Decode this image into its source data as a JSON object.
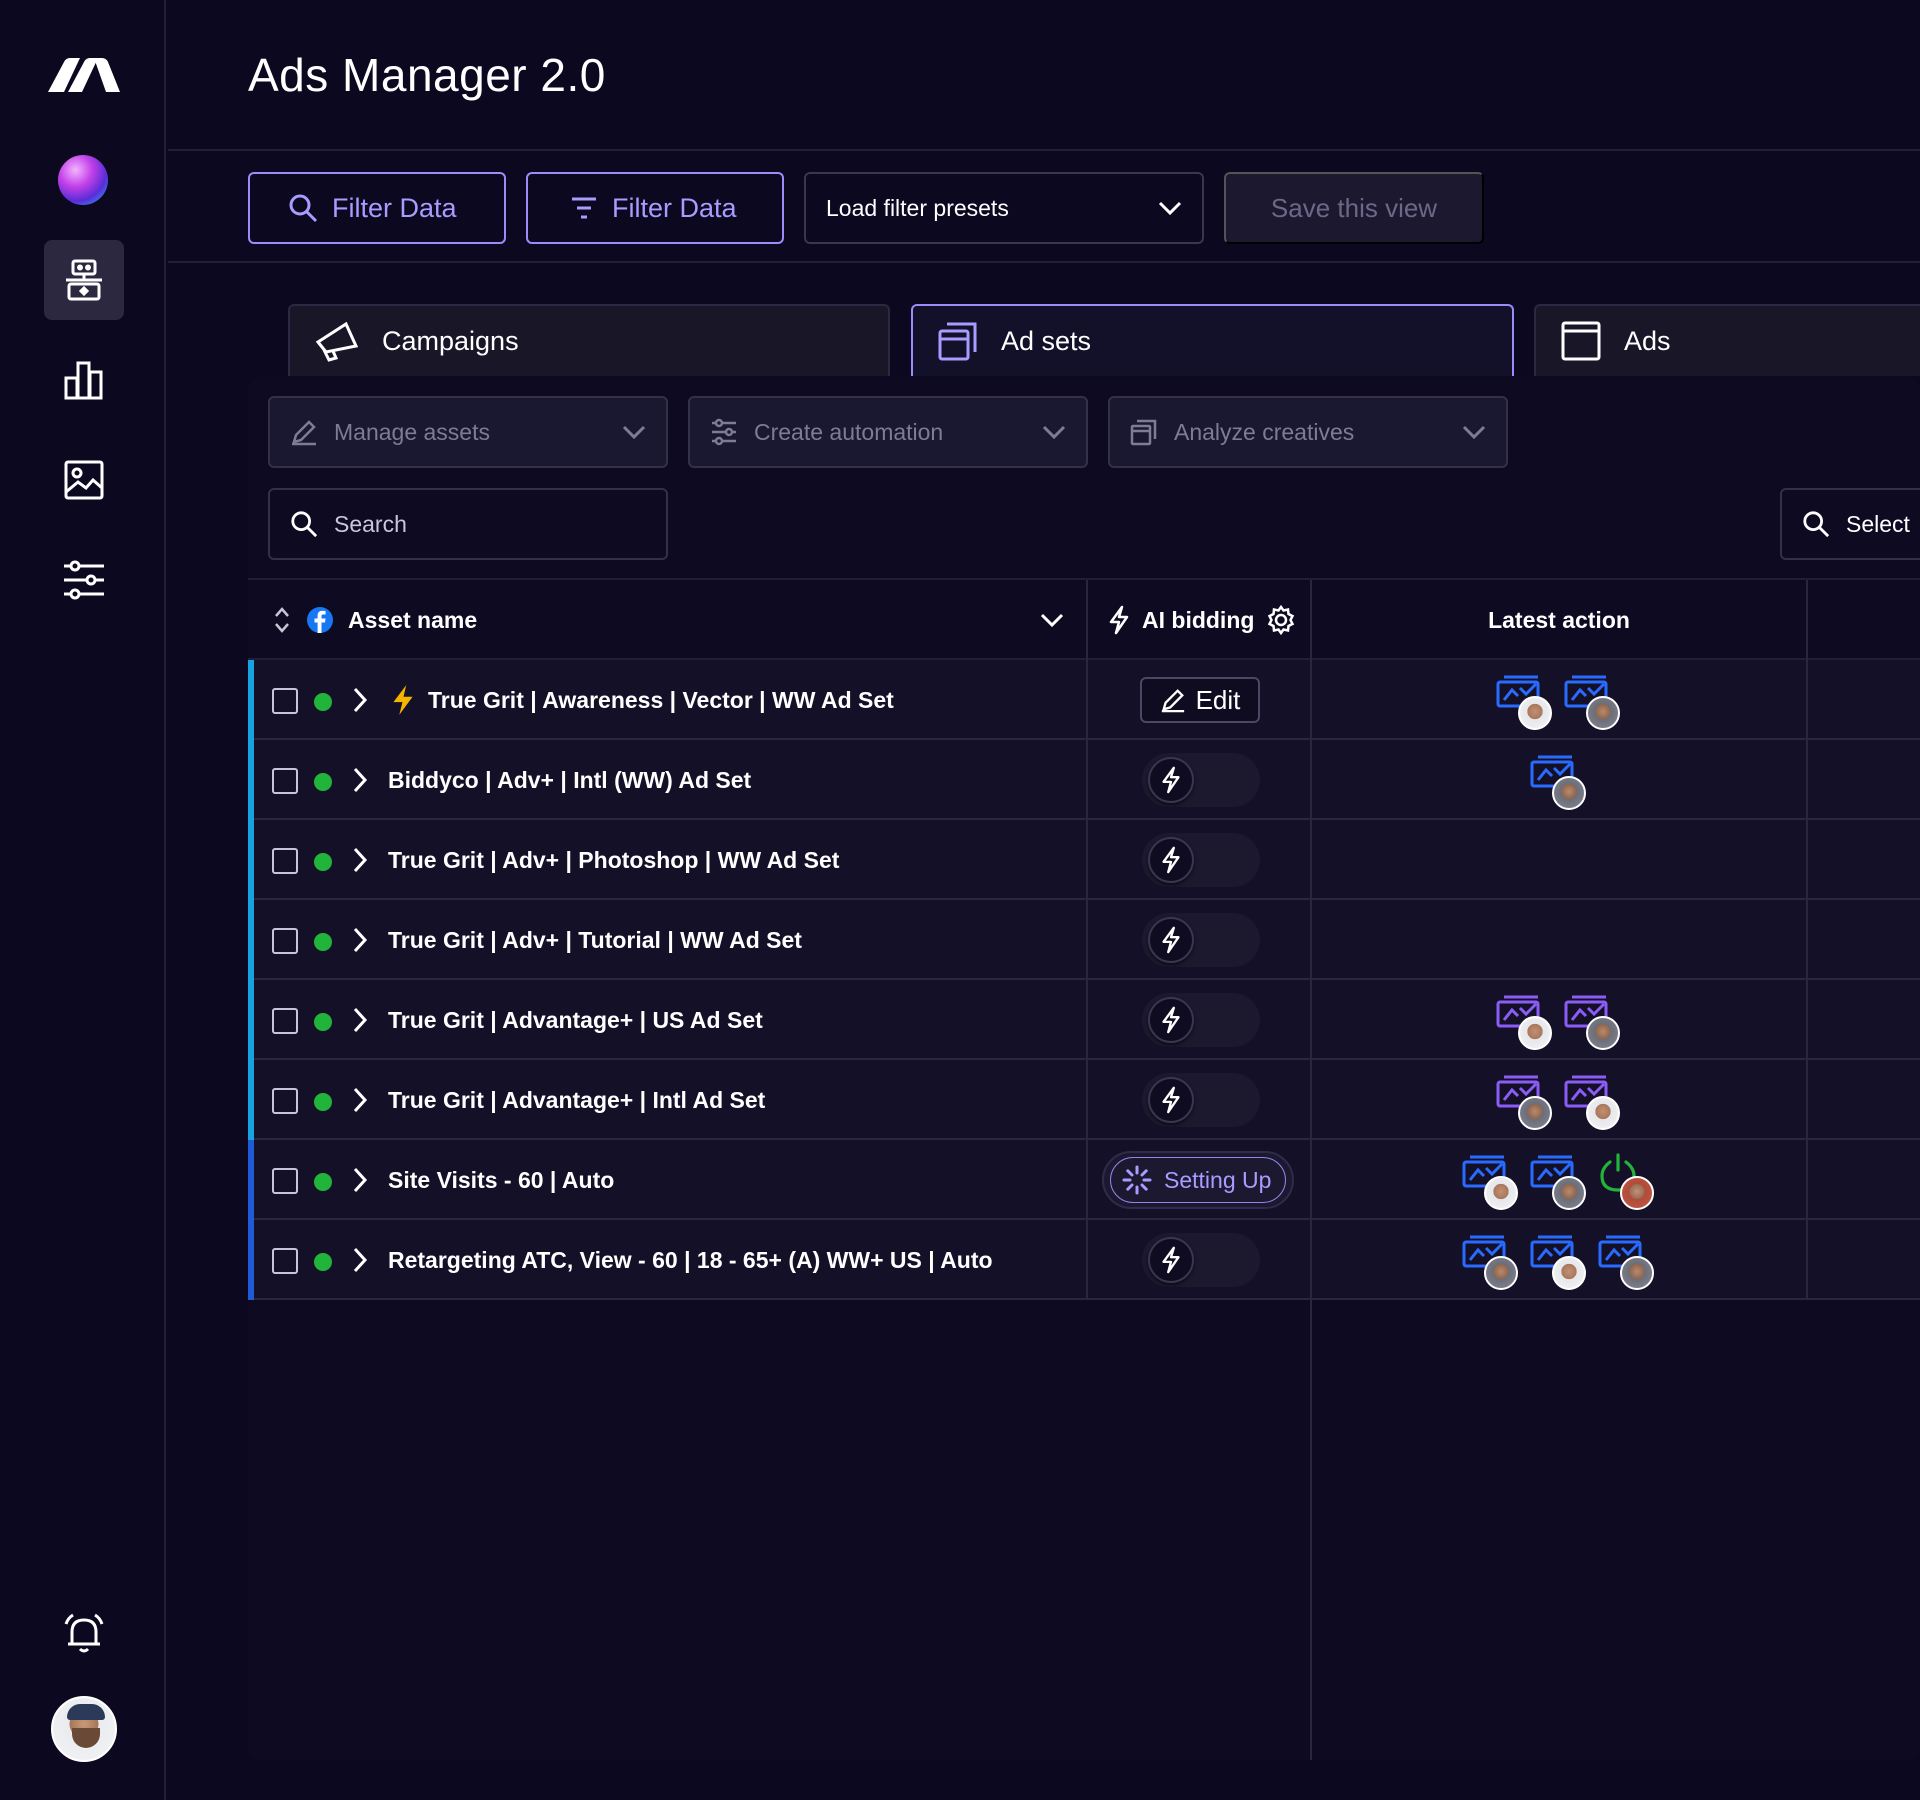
{
  "app": {
    "title": "Ads Manager 2.0"
  },
  "toolbar": {
    "filter_search_label": "Filter Data",
    "filter_label": "Filter Data",
    "presets_placeholder": "Load filter presets",
    "save_view_label": "Save this view"
  },
  "tabs": [
    {
      "label": "Campaigns",
      "icon": "megaphone-icon"
    },
    {
      "label": "Ad sets",
      "icon": "stacked-pages-icon",
      "active": true
    },
    {
      "label": "Ads",
      "icon": "page-icon"
    }
  ],
  "actions": {
    "manage_assets": "Manage assets",
    "create_automation": "Create automation",
    "analyze_creatives": "Analyze creatives",
    "search_placeholder": "Search",
    "select_label": "Select"
  },
  "table": {
    "columns": {
      "asset_name": "Asset name",
      "ai_bidding": "AI bidding",
      "latest_action": "Latest action"
    },
    "edit_label": "Edit",
    "setting_up_label": "Setting Up",
    "rows": [
      {
        "name": "True Grit | Awareness | Vector | WW Ad Set",
        "bolt": true,
        "bidding": "edit",
        "actions": [
          "blue",
          "blue"
        ],
        "stripe": "#17a3e0"
      },
      {
        "name": "Biddyco | Adv+ | Intl (WW) Ad Set",
        "bolt": false,
        "bidding": "toggle",
        "actions": [
          "blue"
        ],
        "stripe": "#17a3e0"
      },
      {
        "name": "True Grit | Adv+ | Photoshop | WW Ad Set",
        "bolt": false,
        "bidding": "toggle",
        "actions": [],
        "stripe": "#17a3e0"
      },
      {
        "name": "True Grit | Adv+ | Tutorial | WW Ad Set",
        "bolt": false,
        "bidding": "toggle",
        "actions": [],
        "stripe": "#17a3e0"
      },
      {
        "name": "True Grit | Advantage+ | US Ad Set",
        "bolt": false,
        "bidding": "toggle",
        "actions": [
          "purple",
          "purple"
        ],
        "stripe": "#17a3e0"
      },
      {
        "name": "True Grit | Advantage+ | Intl Ad Set",
        "bolt": false,
        "bidding": "toggle",
        "actions": [
          "purple",
          "purple"
        ],
        "stripe": "#17a3e0"
      },
      {
        "name": "Site Visits - 60 | Auto",
        "bolt": false,
        "bidding": "setting_up",
        "actions": [
          "blue",
          "blue",
          "power"
        ],
        "stripe": "#1f5bd8"
      },
      {
        "name": "Retargeting ATC, View - 60 | 18 - 65+ (A) WW+ US | Auto",
        "bolt": false,
        "bidding": "toggle",
        "actions": [
          "blue",
          "blue",
          "blue"
        ],
        "stripe": "#1f5bd8"
      }
    ]
  },
  "colors": {
    "accent": "#9a8dfb",
    "background": "#0b0820",
    "status_active": "#22b33a",
    "action_blue": "#2a6bff",
    "action_purple": "#8b5cf6",
    "facebook_blue": "#1877f2"
  }
}
